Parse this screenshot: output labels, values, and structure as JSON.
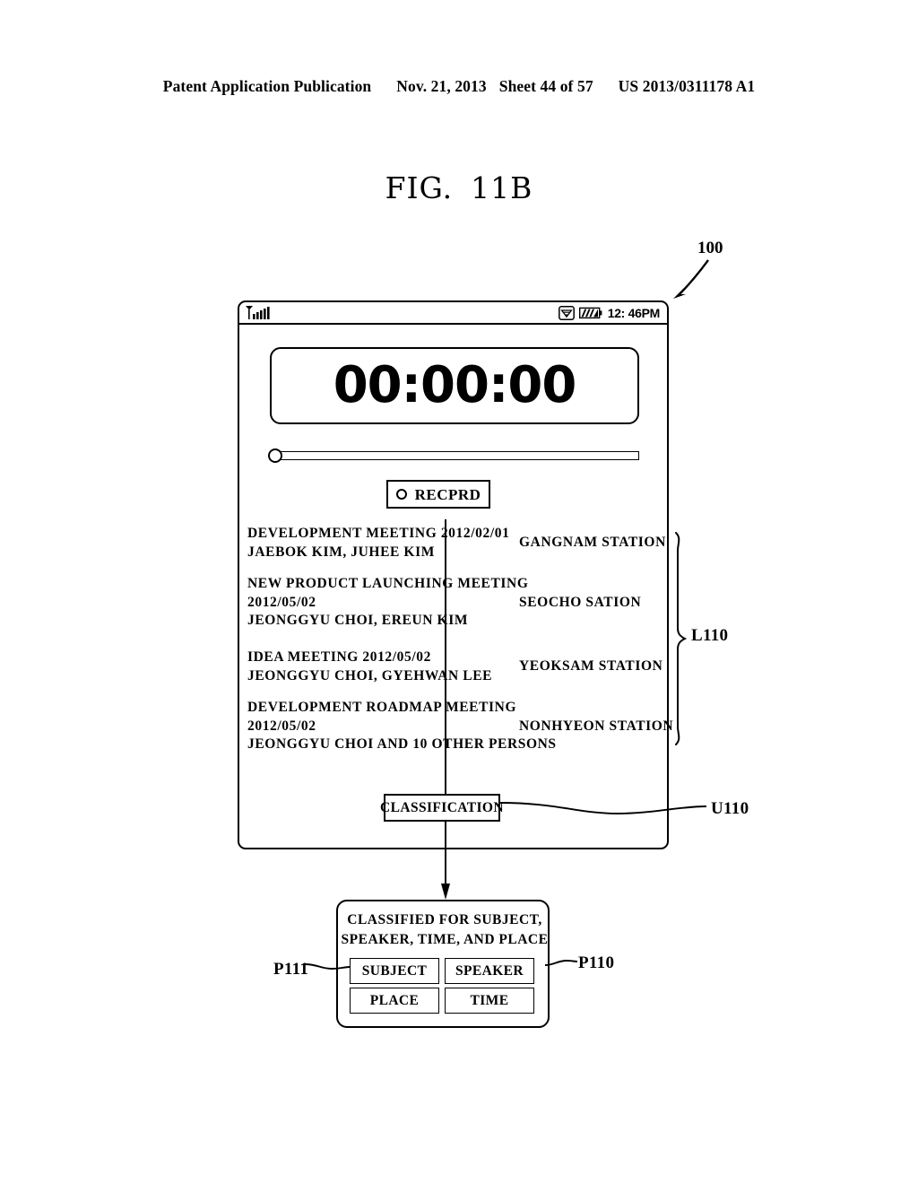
{
  "page_header": {
    "publication": "Patent Application Publication",
    "date": "Nov. 21, 2013",
    "sheet": "Sheet 44 of 57",
    "patent_number": "US 2013/0311178 A1"
  },
  "figure": {
    "label": "FIG.",
    "number": "11B",
    "device_ref": "100"
  },
  "device": {
    "status_bar": {
      "signal_icon": "signal-bars-icon",
      "wifi_icon": "wifi-icon",
      "battery_icon": "battery-icon",
      "time": "12: 46PM"
    },
    "timer": {
      "value": "00:00:00"
    },
    "slider": {
      "position_percent": 0
    },
    "record_button": {
      "icon": "record-circle-icon",
      "label": "RECPRD"
    },
    "list": {
      "ref": "L110",
      "rows": [
        {
          "lines": [
            "DEVELOPMENT MEETING 2012/02/01",
            "JAEBOK KIM, JUHEE KIM"
          ],
          "place": "GANGNAM STATION"
        },
        {
          "lines": [
            "NEW PRODUCT LAUNCHING MEETING",
            "2012/05/02",
            "JEONGGYU CHOI, EREUN KIM"
          ],
          "place": "SEOCHO SATION"
        },
        {
          "lines": [
            "IDEA MEETING 2012/05/02",
            "JEONGGYU CHOI, GYEHWAN LEE"
          ],
          "place": "YEOKSAM STATION"
        },
        {
          "lines": [
            "DEVELOPMENT ROADMAP MEETING",
            "2012/05/02",
            "JEONGGYU CHOI AND 10 OTHER PERSONS"
          ],
          "place": "NONHYEON STATION"
        }
      ]
    },
    "classification_button": {
      "label": "CLASSIFICATION",
      "ref": "U110"
    }
  },
  "popup": {
    "ref": "P110",
    "buttons_ref": "P111",
    "message_line1": "CLASSIFIED FOR SUBJECT,",
    "message_line2": "SPEAKER, TIME, AND PLACE",
    "buttons": [
      {
        "label": "SUBJECT"
      },
      {
        "label": "SPEAKER"
      },
      {
        "label": "PLACE"
      },
      {
        "label": "TIME"
      }
    ]
  }
}
